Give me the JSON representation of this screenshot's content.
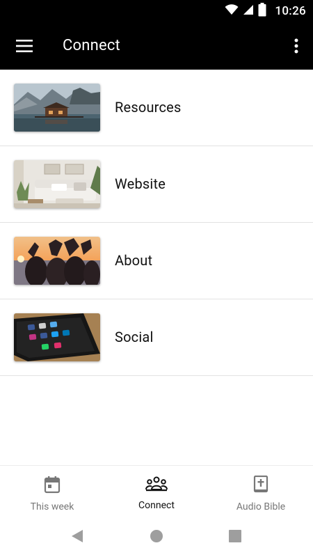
{
  "status_bar": {
    "time": "10:26",
    "icons": [
      "wifi-icon",
      "cell-signal-icon",
      "battery-icon"
    ]
  },
  "app_bar": {
    "title": "Connect",
    "menu_icon": "hamburger-menu-icon",
    "overflow_icon": "more-vert-icon"
  },
  "list": {
    "items": [
      {
        "label": "Resources",
        "thumbnail": "lake-cabin-mountains-photo"
      },
      {
        "label": "Website",
        "thumbnail": "living-room-sofa-photo"
      },
      {
        "label": "About",
        "thumbnail": "hands-heart-sunset-photo"
      },
      {
        "label": "Social",
        "thumbnail": "phone-social-media-photo"
      }
    ]
  },
  "bottom_nav": {
    "items": [
      {
        "label": "This week",
        "icon": "calendar-icon",
        "active": false
      },
      {
        "label": "Connect",
        "icon": "group-icon",
        "active": true
      },
      {
        "label": "Audio Bible",
        "icon": "bible-book-icon",
        "active": false
      }
    ]
  },
  "colors": {
    "app_bar_bg": "#000000",
    "active_label": "#111111",
    "inactive_label": "#777777",
    "divider": "#e2e2e2"
  }
}
